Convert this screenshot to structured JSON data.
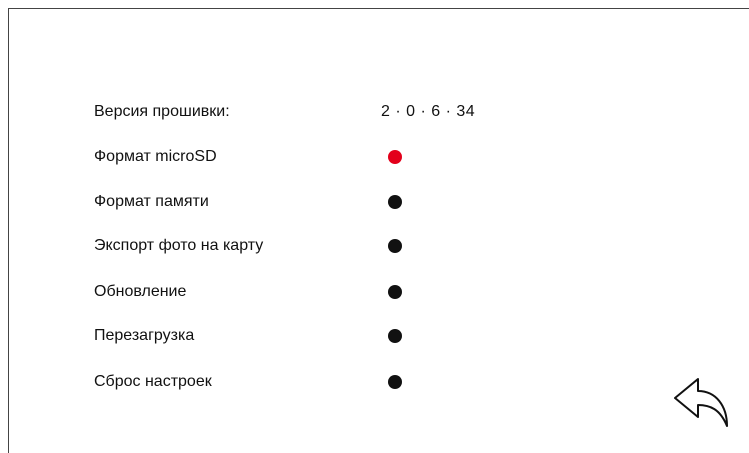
{
  "firmware": {
    "label": "Версия прошивки:",
    "value": "2 · 0 · 6 · 34"
  },
  "menu": [
    {
      "label": "Формат microSD",
      "indicator": "active-dot"
    },
    {
      "label": "Формат памяти",
      "indicator": "dot"
    },
    {
      "label": "Экспорт фото на карту",
      "indicator": "dot"
    },
    {
      "label": "Обновление",
      "indicator": "dot"
    },
    {
      "label": "Перезагрузка",
      "indicator": "dot"
    },
    {
      "label": "Сброс настроек",
      "indicator": "dot"
    }
  ],
  "colors": {
    "active": "#e3001b",
    "inactive": "#111111"
  },
  "back_button": {
    "icon": "back-arrow-icon"
  }
}
